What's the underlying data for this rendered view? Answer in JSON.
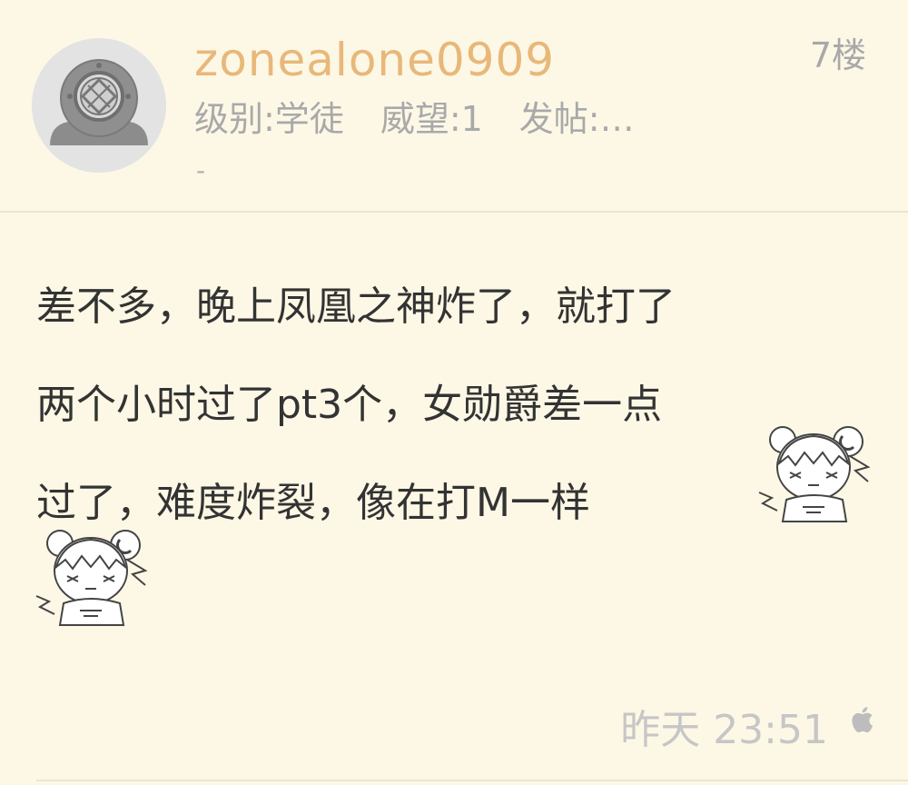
{
  "post": {
    "username": "zonealone0909",
    "floor": "7楼",
    "meta": {
      "level": "级别:学徒",
      "prestige": "威望:1",
      "posts": "发帖:…",
      "dash": "-"
    },
    "content_lines": [
      "差不多，晚上凤凰之神炸了，就打了",
      "两个小时过了pt3个，女勋爵差一点",
      "过了，难度炸裂，像在打M一样"
    ],
    "timestamp": "昨天 23:51",
    "device_icon": "apple-icon",
    "avatar_icon": "diving-helmet-icon",
    "sticker_icon": "anime-girl-sticker-icon"
  },
  "colors": {
    "background": "#fdf8e6",
    "username": "#e8b87a",
    "meta_text": "#a9a9a9",
    "body_text": "#333333",
    "timestamp": "#c6c6c6"
  }
}
